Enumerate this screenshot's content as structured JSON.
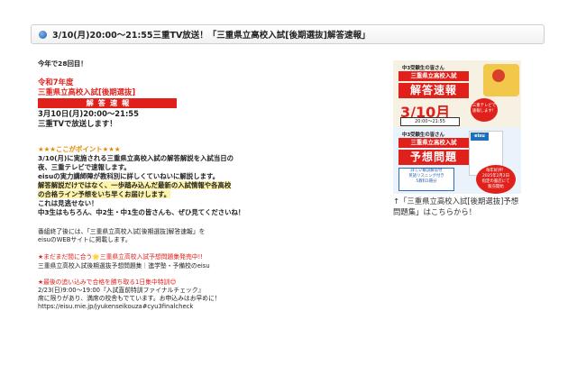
{
  "header": {
    "title": "3/10(月)20:00～21:55三重TV放送！「三重県立高校入試[後期選抜]解答速報」"
  },
  "left": {
    "intro": "今年で28回目！",
    "r1": "令和7年度",
    "r2": "三重県立高校入試[後期選抜]",
    "banner": "解答速報",
    "datetime": "3月10日(月)20:00～21:55",
    "broadcast": "三重TVで放送します！",
    "point_title": "★★★ここがポイント★★★",
    "point_lines": [
      "3/10(月)に実施される三重県立高校入試の解答解説を入試当日の",
      "夜、三重テレビで速報します。",
      "eisuの実力講師陣が教科別に詳しくていねいに解説します。",
      "解答解説だけではなく、一歩踏み込んだ最新の入試情報や各高校",
      "の合格ライン予想をいち早くお届けします。",
      "これは見逃せない！",
      "中3生はもちろん、中2生・中1生の皆さんも、ぜひ見てくださいね！"
    ],
    "after_lines": [
      "番組終了後には、「三重県立高校入試[後期選抜]解答速報」を",
      "eisuのWEBサイトに掲載します。"
    ],
    "promo1_title": "★まだまだ間に合う🌟三重県立高校入試予想問題集発売中!!",
    "promo1_text": "三重県立高校入試後期選抜予想問題集｜進学塾・予備校のeisu",
    "promo2_title": "★最後の追い込みで合格を勝ち取る1日集中特訓😊",
    "promo2_lines": [
      "2/23(日)9:00～19:00『入試直前特訓ファイナルチェック』",
      "席に限りがあり、満席の校舎もでています。お申込みはお早めに！",
      "https://eisu.mie.jp/jyukenseikouza#cyu3finalcheck"
    ]
  },
  "poster": {
    "sub1": "中3受験生の皆さん",
    "title1": "三重県立高校入試",
    "kaito": "解答速報",
    "date": "3/10月",
    "time": "20:00～21:55",
    "tv": "三重テレビで速報します！",
    "sub2": "中3受験生の皆さん",
    "title2": "三重県立高校入試",
    "yoso": "予想問題",
    "notes": [
      "詳しい解説解答付",
      "英語リスニング付き",
      "5教科1冊分"
    ],
    "eisu": "eisu",
    "star": [
      "毎年好評！",
      "2025年2月2日",
      "指定の書店にて",
      "販売開始"
    ]
  },
  "caption": "↑「三重県立高校入試[後期選抜]予想問題集」はこちらから！"
}
